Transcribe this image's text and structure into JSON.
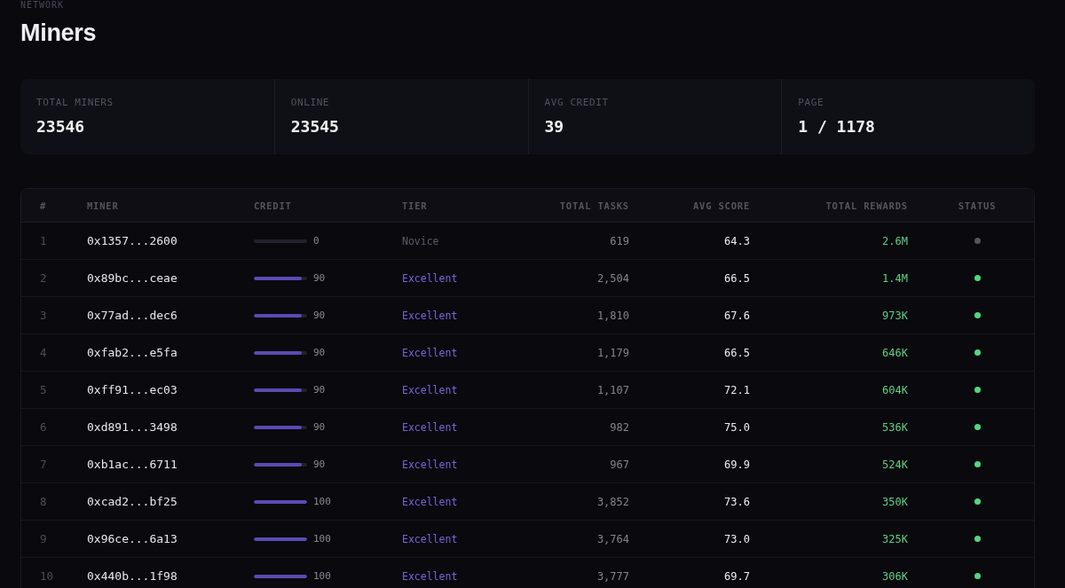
{
  "header": {
    "eyebrow": "NETWORK",
    "title": "Miners"
  },
  "stats": [
    {
      "label": "TOTAL MINERS",
      "value": "23546"
    },
    {
      "label": "ONLINE",
      "value": "23545"
    },
    {
      "label": "AVG CREDIT",
      "value": "39"
    },
    {
      "label": "PAGE",
      "value": "1 / 1178"
    }
  ],
  "table": {
    "columns": [
      "#",
      "MINER",
      "CREDIT",
      "TIER",
      "TOTAL TASKS",
      "AVG SCORE",
      "TOTAL REWARDS",
      "STATUS"
    ],
    "rows": [
      {
        "rank": "1",
        "miner": "0x1357...2600",
        "credit": {
          "level": 0,
          "reading": "0"
        },
        "tier": {
          "label": "Novice",
          "color": "#5c5c68"
        },
        "total_tasks": "619",
        "avg_score": "64.3",
        "total_rewards": "2.6M",
        "online": false
      },
      {
        "rank": "2",
        "miner": "0x89bc...ceae",
        "credit": {
          "level": 0.9,
          "reading": "90"
        },
        "tier": {
          "label": "Excellent",
          "color": "#7766d8"
        },
        "total_tasks": "2,504",
        "avg_score": "66.5",
        "total_rewards": "1.4M",
        "online": true
      },
      {
        "rank": "3",
        "miner": "0x77ad...dec6",
        "credit": {
          "level": 0.9,
          "reading": "90"
        },
        "tier": {
          "label": "Excellent",
          "color": "#7766d8"
        },
        "total_tasks": "1,810",
        "avg_score": "67.6",
        "total_rewards": "973K",
        "online": true
      },
      {
        "rank": "4",
        "miner": "0xfab2...e5fa",
        "credit": {
          "level": 0.9,
          "reading": "90"
        },
        "tier": {
          "label": "Excellent",
          "color": "#7766d8"
        },
        "total_tasks": "1,179",
        "avg_score": "66.5",
        "total_rewards": "646K",
        "online": true
      },
      {
        "rank": "5",
        "miner": "0xff91...ec03",
        "credit": {
          "level": 0.9,
          "reading": "90"
        },
        "tier": {
          "label": "Excellent",
          "color": "#7766d8"
        },
        "total_tasks": "1,107",
        "avg_score": "72.1",
        "total_rewards": "604K",
        "online": true
      },
      {
        "rank": "6",
        "miner": "0xd891...3498",
        "credit": {
          "level": 0.9,
          "reading": "90"
        },
        "tier": {
          "label": "Excellent",
          "color": "#7766d8"
        },
        "total_tasks": "982",
        "avg_score": "75.0",
        "total_rewards": "536K",
        "online": true
      },
      {
        "rank": "7",
        "miner": "0xb1ac...6711",
        "credit": {
          "level": 0.9,
          "reading": "90"
        },
        "tier": {
          "label": "Excellent",
          "color": "#7766d8"
        },
        "total_tasks": "967",
        "avg_score": "69.9",
        "total_rewards": "524K",
        "online": true
      },
      {
        "rank": "8",
        "miner": "0xcad2...bf25",
        "credit": {
          "level": 1,
          "reading": "100"
        },
        "tier": {
          "label": "Excellent",
          "color": "#7766d8"
        },
        "total_tasks": "3,852",
        "avg_score": "73.6",
        "total_rewards": "350K",
        "online": true
      },
      {
        "rank": "9",
        "miner": "0x96ce...6a13",
        "credit": {
          "level": 1,
          "reading": "100"
        },
        "tier": {
          "label": "Excellent",
          "color": "#7766d8"
        },
        "total_tasks": "3,764",
        "avg_score": "73.0",
        "total_rewards": "325K",
        "online": true
      },
      {
        "rank": "10",
        "miner": "0x440b...1f98",
        "credit": {
          "level": 1,
          "reading": "100"
        },
        "tier": {
          "label": "Excellent",
          "color": "#7766d8"
        },
        "total_tasks": "3,777",
        "avg_score": "69.7",
        "total_rewards": "306K",
        "online": true
      }
    ]
  }
}
